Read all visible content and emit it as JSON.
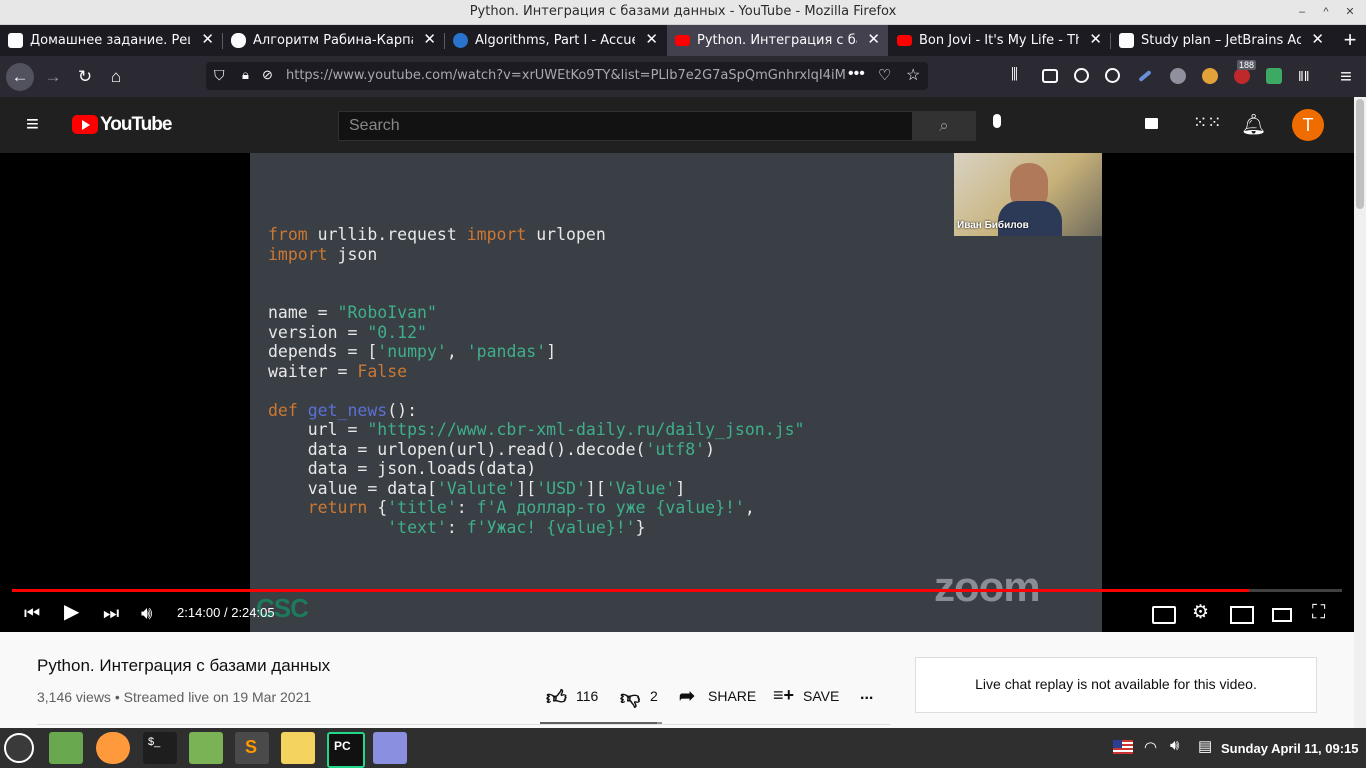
{
  "window": {
    "title": "Python. Интеграция с базами данных - YouTube - Mozilla Firefox"
  },
  "tabs": [
    {
      "label": "Домашнее задание. Реше",
      "icon": "generic-site-icon",
      "active": false
    },
    {
      "label": "Алгоритм Рабина-Карпа с",
      "icon": "medium-icon",
      "active": false
    },
    {
      "label": "Algorithms, Part I - Accueil",
      "icon": "coursera-icon",
      "active": false
    },
    {
      "label": "Python. Интеграция с баз",
      "icon": "youtube-icon",
      "active": true
    },
    {
      "label": "Bon Jovi - It's My Life - The",
      "icon": "youtube-icon",
      "active": false
    },
    {
      "label": "Study plan – JetBrains Aca",
      "icon": "jetbrains-icon",
      "active": false
    }
  ],
  "new_tab_label": "+",
  "nav": {
    "url": "https://www.youtube.com/watch?v=xrUWEtKo9TY&list=PLlb7e2G7aSpQmGnhrxlqI4iMXNv4",
    "badge_count": "188"
  },
  "yt": {
    "logo": "YouTube",
    "search_placeholder": "Search",
    "avatar_letter": "T"
  },
  "video": {
    "presenter_name": "Иван Бибилов",
    "watermark": "zoom",
    "corner_logo": "CSC",
    "time": "2:14:00 / 2:24:05",
    "progress": 0.93
  },
  "slide_code": [
    [
      {
        "t": "from",
        "c": "kw"
      },
      {
        "t": " urllib.request ",
        "c": ""
      },
      {
        "t": "import",
        "c": "kw"
      },
      {
        "t": " urlopen",
        "c": ""
      }
    ],
    [
      {
        "t": "import",
        "c": "kw"
      },
      {
        "t": " json",
        "c": ""
      }
    ],
    [],
    [],
    [
      {
        "t": "name = ",
        "c": ""
      },
      {
        "t": "\"RoboIvan\"",
        "c": "str"
      }
    ],
    [
      {
        "t": "version = ",
        "c": ""
      },
      {
        "t": "\"0.12\"",
        "c": "str"
      }
    ],
    [
      {
        "t": "depends = [",
        "c": ""
      },
      {
        "t": "'numpy'",
        "c": "str"
      },
      {
        "t": ", ",
        "c": ""
      },
      {
        "t": "'pandas'",
        "c": "str"
      },
      {
        "t": "]",
        "c": ""
      }
    ],
    [
      {
        "t": "waiter = ",
        "c": ""
      },
      {
        "t": "False",
        "c": "kw"
      }
    ],
    [],
    [
      {
        "t": "def",
        "c": "kw"
      },
      {
        "t": " ",
        "c": ""
      },
      {
        "t": "get_news",
        "c": "fn"
      },
      {
        "t": "():",
        "c": ""
      }
    ],
    [
      {
        "t": "    url = ",
        "c": ""
      },
      {
        "t": "\"https://www.cbr-xml-daily.ru/daily_json.js\"",
        "c": "str"
      }
    ],
    [
      {
        "t": "    data = urlopen(url).read().decode(",
        "c": ""
      },
      {
        "t": "'utf8'",
        "c": "str"
      },
      {
        "t": ")",
        "c": ""
      }
    ],
    [
      {
        "t": "    data = json.loads(data)",
        "c": ""
      }
    ],
    [
      {
        "t": "    value = data[",
        "c": ""
      },
      {
        "t": "'Valute'",
        "c": "str"
      },
      {
        "t": "][",
        "c": ""
      },
      {
        "t": "'USD'",
        "c": "str"
      },
      {
        "t": "][",
        "c": ""
      },
      {
        "t": "'Value'",
        "c": "str"
      },
      {
        "t": "]",
        "c": ""
      }
    ],
    [
      {
        "t": "    ",
        "c": ""
      },
      {
        "t": "return",
        "c": "kw"
      },
      {
        "t": " {",
        "c": ""
      },
      {
        "t": "'title'",
        "c": "str"
      },
      {
        "t": ": ",
        "c": ""
      },
      {
        "t": "f'А доллар-то уже {value}!'",
        "c": "str"
      },
      {
        "t": ",",
        "c": ""
      }
    ],
    [
      {
        "t": "            ",
        "c": ""
      },
      {
        "t": "'text'",
        "c": "str"
      },
      {
        "t": ": ",
        "c": ""
      },
      {
        "t": "f'Ужас! {value}!'",
        "c": "str"
      },
      {
        "t": "}",
        "c": ""
      }
    ]
  ],
  "below": {
    "title": "Python. Интеграция с базами данных",
    "meta": "3,146 views • Streamed live on 19 Mar 2021",
    "likes": "116",
    "dislikes": "2",
    "share_label": "SHARE",
    "save_label": "SAVE",
    "more_label": "...",
    "chat_message": "Live chat replay is not available for this video."
  },
  "taskbar": {
    "clock": "Sunday April 11, 09:15",
    "terminal_label": "$_",
    "pycharm_label": "PC"
  },
  "colors": {
    "yt_red": "#ff0000",
    "keyword": "#cc7832",
    "string": "#3fae8e",
    "function": "#5b6fd6",
    "avatar_bg": "#ef6c00"
  }
}
